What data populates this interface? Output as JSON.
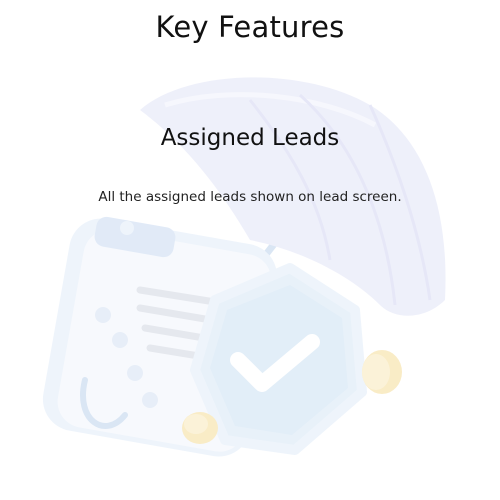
{
  "header": {
    "title": "Key Features"
  },
  "feature": {
    "title": "Assigned Leads",
    "description": "All the assigned leads shown on lead screen."
  },
  "illustration": {
    "icons": [
      "umbrella-icon",
      "clipboard-checklist-icon",
      "shield-check-icon",
      "coin-icon"
    ],
    "colors": {
      "umbrella": "#d9dcf5",
      "clipboard": "#cfe0f5",
      "shield": "#bcd7f0",
      "coin": "#f3d27a"
    }
  }
}
